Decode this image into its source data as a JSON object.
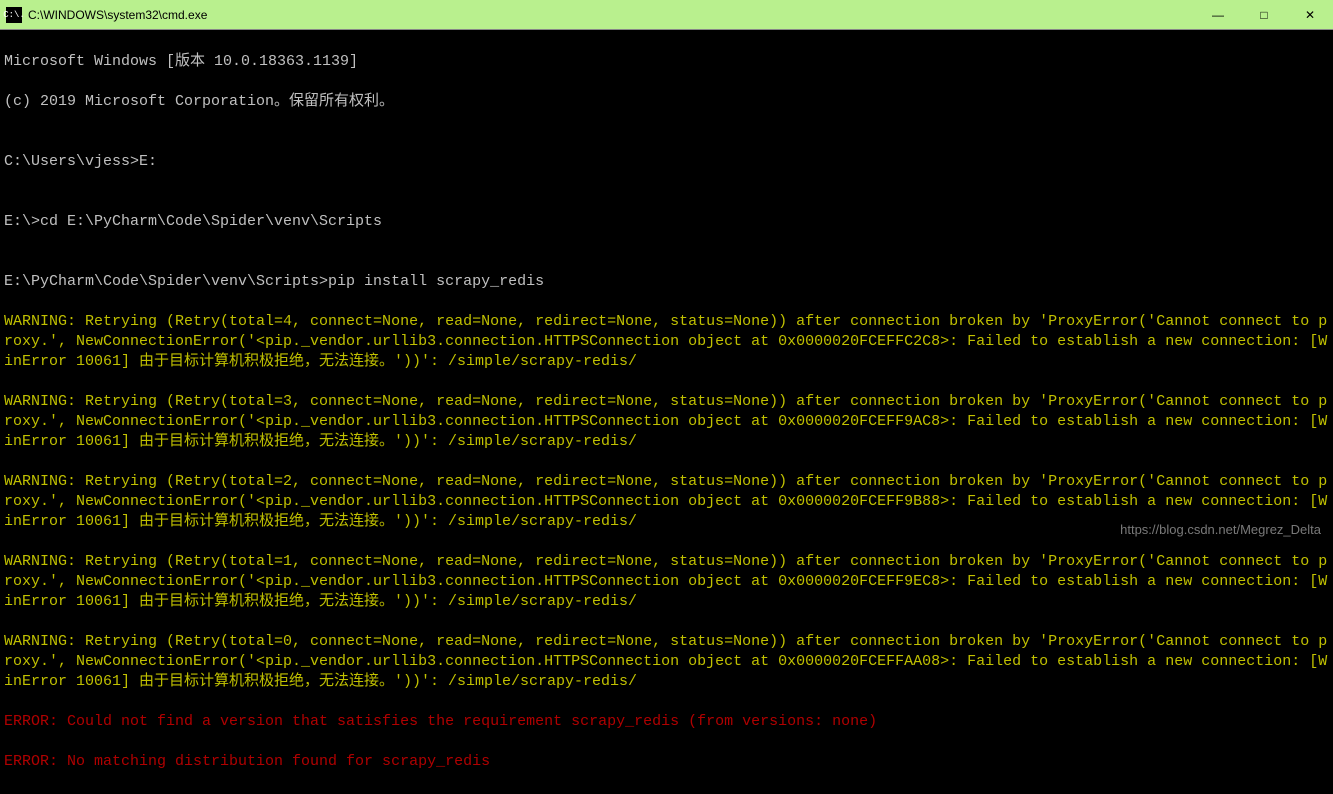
{
  "titlebar": {
    "icon_text": "C:\\.",
    "title": "C:\\WINDOWS\\system32\\cmd.exe",
    "minimize": "—",
    "maximize": "□",
    "close": "✕"
  },
  "terminal": {
    "line1": "Microsoft Windows [版本 10.0.18363.1139]",
    "line2": "(c) 2019 Microsoft Corporation。保留所有权利。",
    "blank1": "",
    "line3": "C:\\Users\\vjess>E:",
    "blank2": "",
    "line4": "E:\\>cd E:\\PyCharm\\Code\\Spider\\venv\\Scripts",
    "blank3": "",
    "line5": "E:\\PyCharm\\Code\\Spider\\venv\\Scripts>pip install scrapy_redis",
    "warn1": "WARNING: Retrying (Retry(total=4, connect=None, read=None, redirect=None, status=None)) after connection broken by 'ProxyError('Cannot connect to proxy.', NewConnectionError('<pip._vendor.urllib3.connection.HTTPSConnection object at 0x0000020FCEFFC2C8>: Failed to establish a new connection: [WinError 10061] 由于目标计算机积极拒绝，无法连接。'))': /simple/scrapy-redis/",
    "warn2": "WARNING: Retrying (Retry(total=3, connect=None, read=None, redirect=None, status=None)) after connection broken by 'ProxyError('Cannot connect to proxy.', NewConnectionError('<pip._vendor.urllib3.connection.HTTPSConnection object at 0x0000020FCEFF9AC8>: Failed to establish a new connection: [WinError 10061] 由于目标计算机积极拒绝，无法连接。'))': /simple/scrapy-redis/",
    "warn3": "WARNING: Retrying (Retry(total=2, connect=None, read=None, redirect=None, status=None)) after connection broken by 'ProxyError('Cannot connect to proxy.', NewConnectionError('<pip._vendor.urllib3.connection.HTTPSConnection object at 0x0000020FCEFF9B88>: Failed to establish a new connection: [WinError 10061] 由于目标计算机积极拒绝，无法连接。'))': /simple/scrapy-redis/",
    "warn4": "WARNING: Retrying (Retry(total=1, connect=None, read=None, redirect=None, status=None)) after connection broken by 'ProxyError('Cannot connect to proxy.', NewConnectionError('<pip._vendor.urllib3.connection.HTTPSConnection object at 0x0000020FCEFF9EC8>: Failed to establish a new connection: [WinError 10061] 由于目标计算机积极拒绝，无法连接。'))': /simple/scrapy-redis/",
    "warn5": "WARNING: Retrying (Retry(total=0, connect=None, read=None, redirect=None, status=None)) after connection broken by 'ProxyError('Cannot connect to proxy.', NewConnectionError('<pip._vendor.urllib3.connection.HTTPSConnection object at 0x0000020FCEFFAA08>: Failed to establish a new connection: [WinError 10061] 由于目标计算机积极拒绝，无法连接。'))': /simple/scrapy-redis/",
    "err1": "ERROR: Could not find a version that satisfies the requirement scrapy_redis (from versions: none)",
    "err2": "ERROR: No matching distribution found for scrapy_redis"
  },
  "watermark": "https://blog.csdn.net/Megrez_Delta"
}
